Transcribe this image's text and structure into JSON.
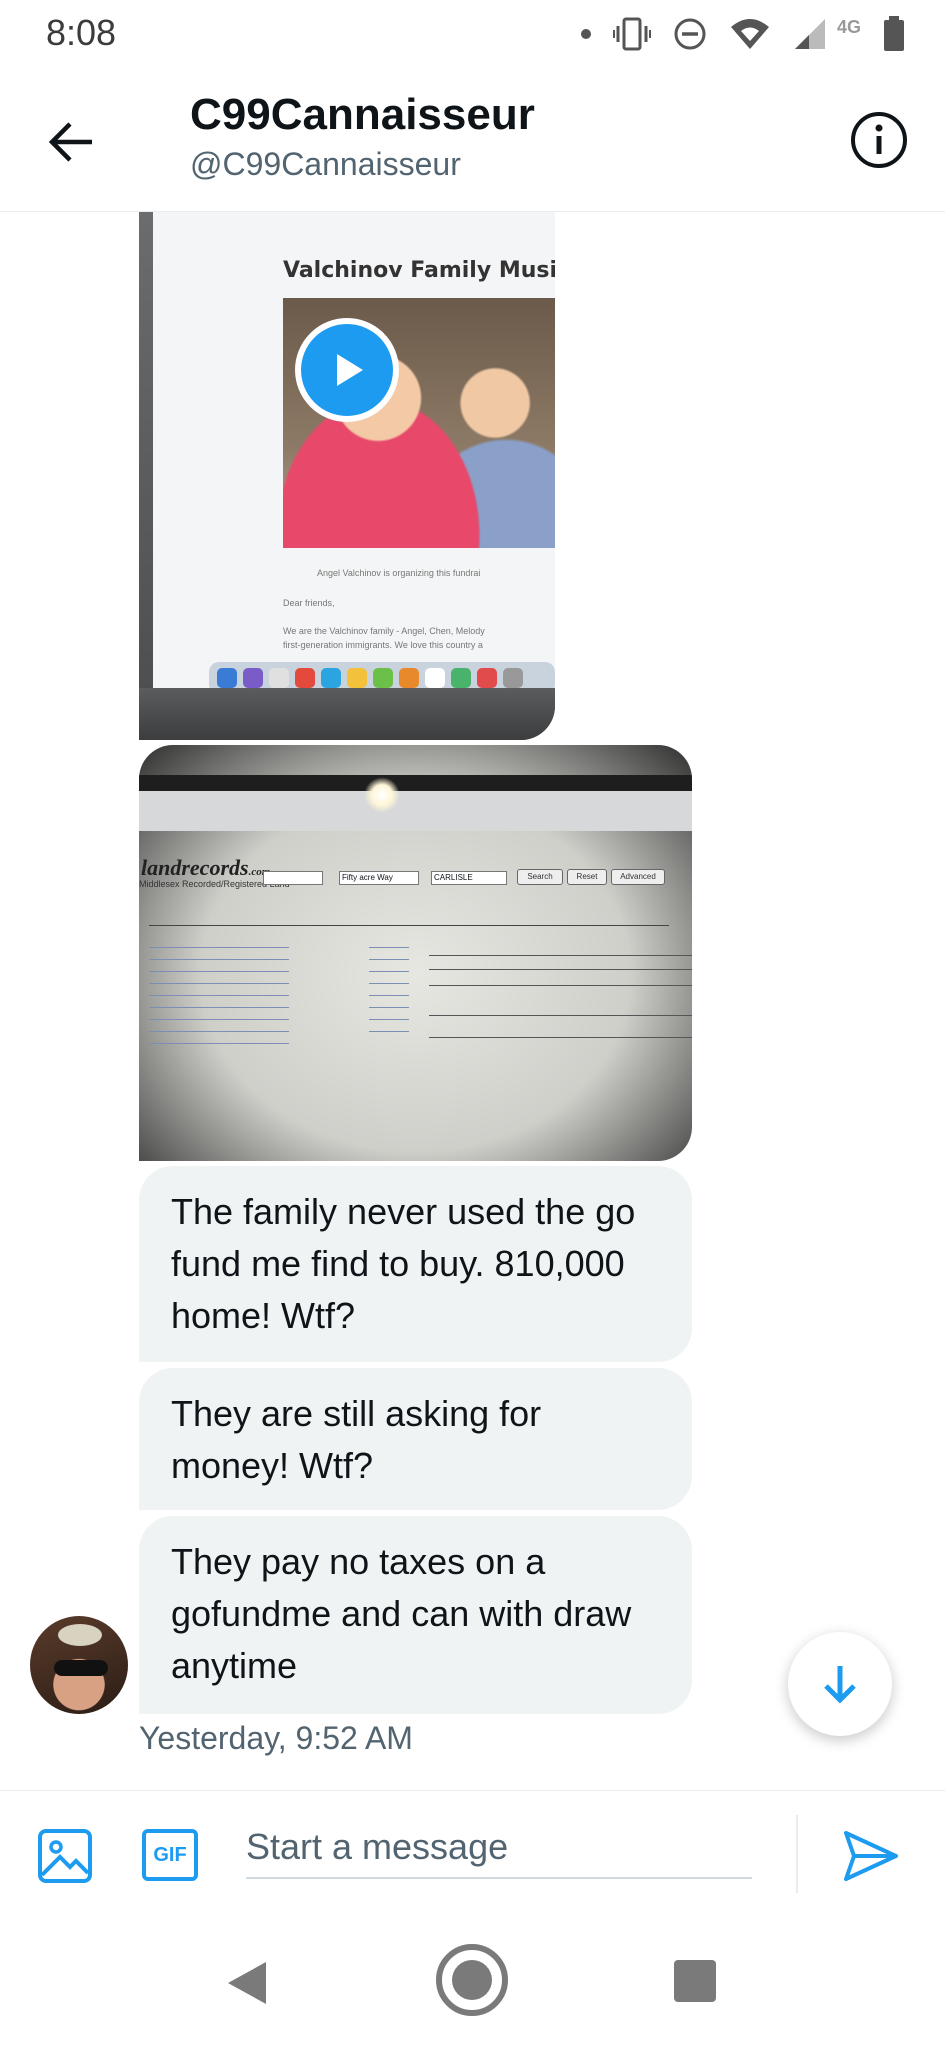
{
  "status_bar": {
    "time": "8:08",
    "network_label": "4G"
  },
  "header": {
    "display_name": "C99Cannaisseur",
    "handle": "@C99Cannaisseur"
  },
  "conversation": {
    "attachment_1": {
      "page_title": "Valchinov Family Musicians",
      "organizer_text": "Angel Valchinov is organizing this fundrai",
      "greeting": "Dear friends,",
      "body_line_1": "We are the Valchinov family - Angel, Chen, Melody",
      "body_line_2": "first-generation immigrants. We love this country a"
    },
    "attachment_2": {
      "site_name": "landrecords",
      "site_suffix": ".com",
      "site_sub": "Middlesex Recorded/Registered Land",
      "street_value": "Fifty acre Way",
      "town_value": "CARLISLE",
      "search_btn": "Search",
      "reset_btn": "Reset",
      "advanced_btn": "Advanced"
    },
    "messages": [
      "The family never used the go fund me find to buy. 810,000 home! Wtf?",
      "They are still asking for money! Wtf?",
      "They pay no taxes on a gofundme and can with draw anytime"
    ],
    "timestamp": "Yesterday, 9:52 AM"
  },
  "composer": {
    "gif_label": "GIF",
    "placeholder": "Start a message"
  },
  "colors": {
    "accent": "#1d9bf0",
    "bubble": "#eff3f4",
    "secondary_text": "#536471"
  },
  "icons": {
    "back": "arrow-left-icon",
    "info": "info-circle-icon",
    "play": "play-icon",
    "scroll_down": "arrow-down-icon",
    "media": "image-icon",
    "send": "send-icon"
  }
}
